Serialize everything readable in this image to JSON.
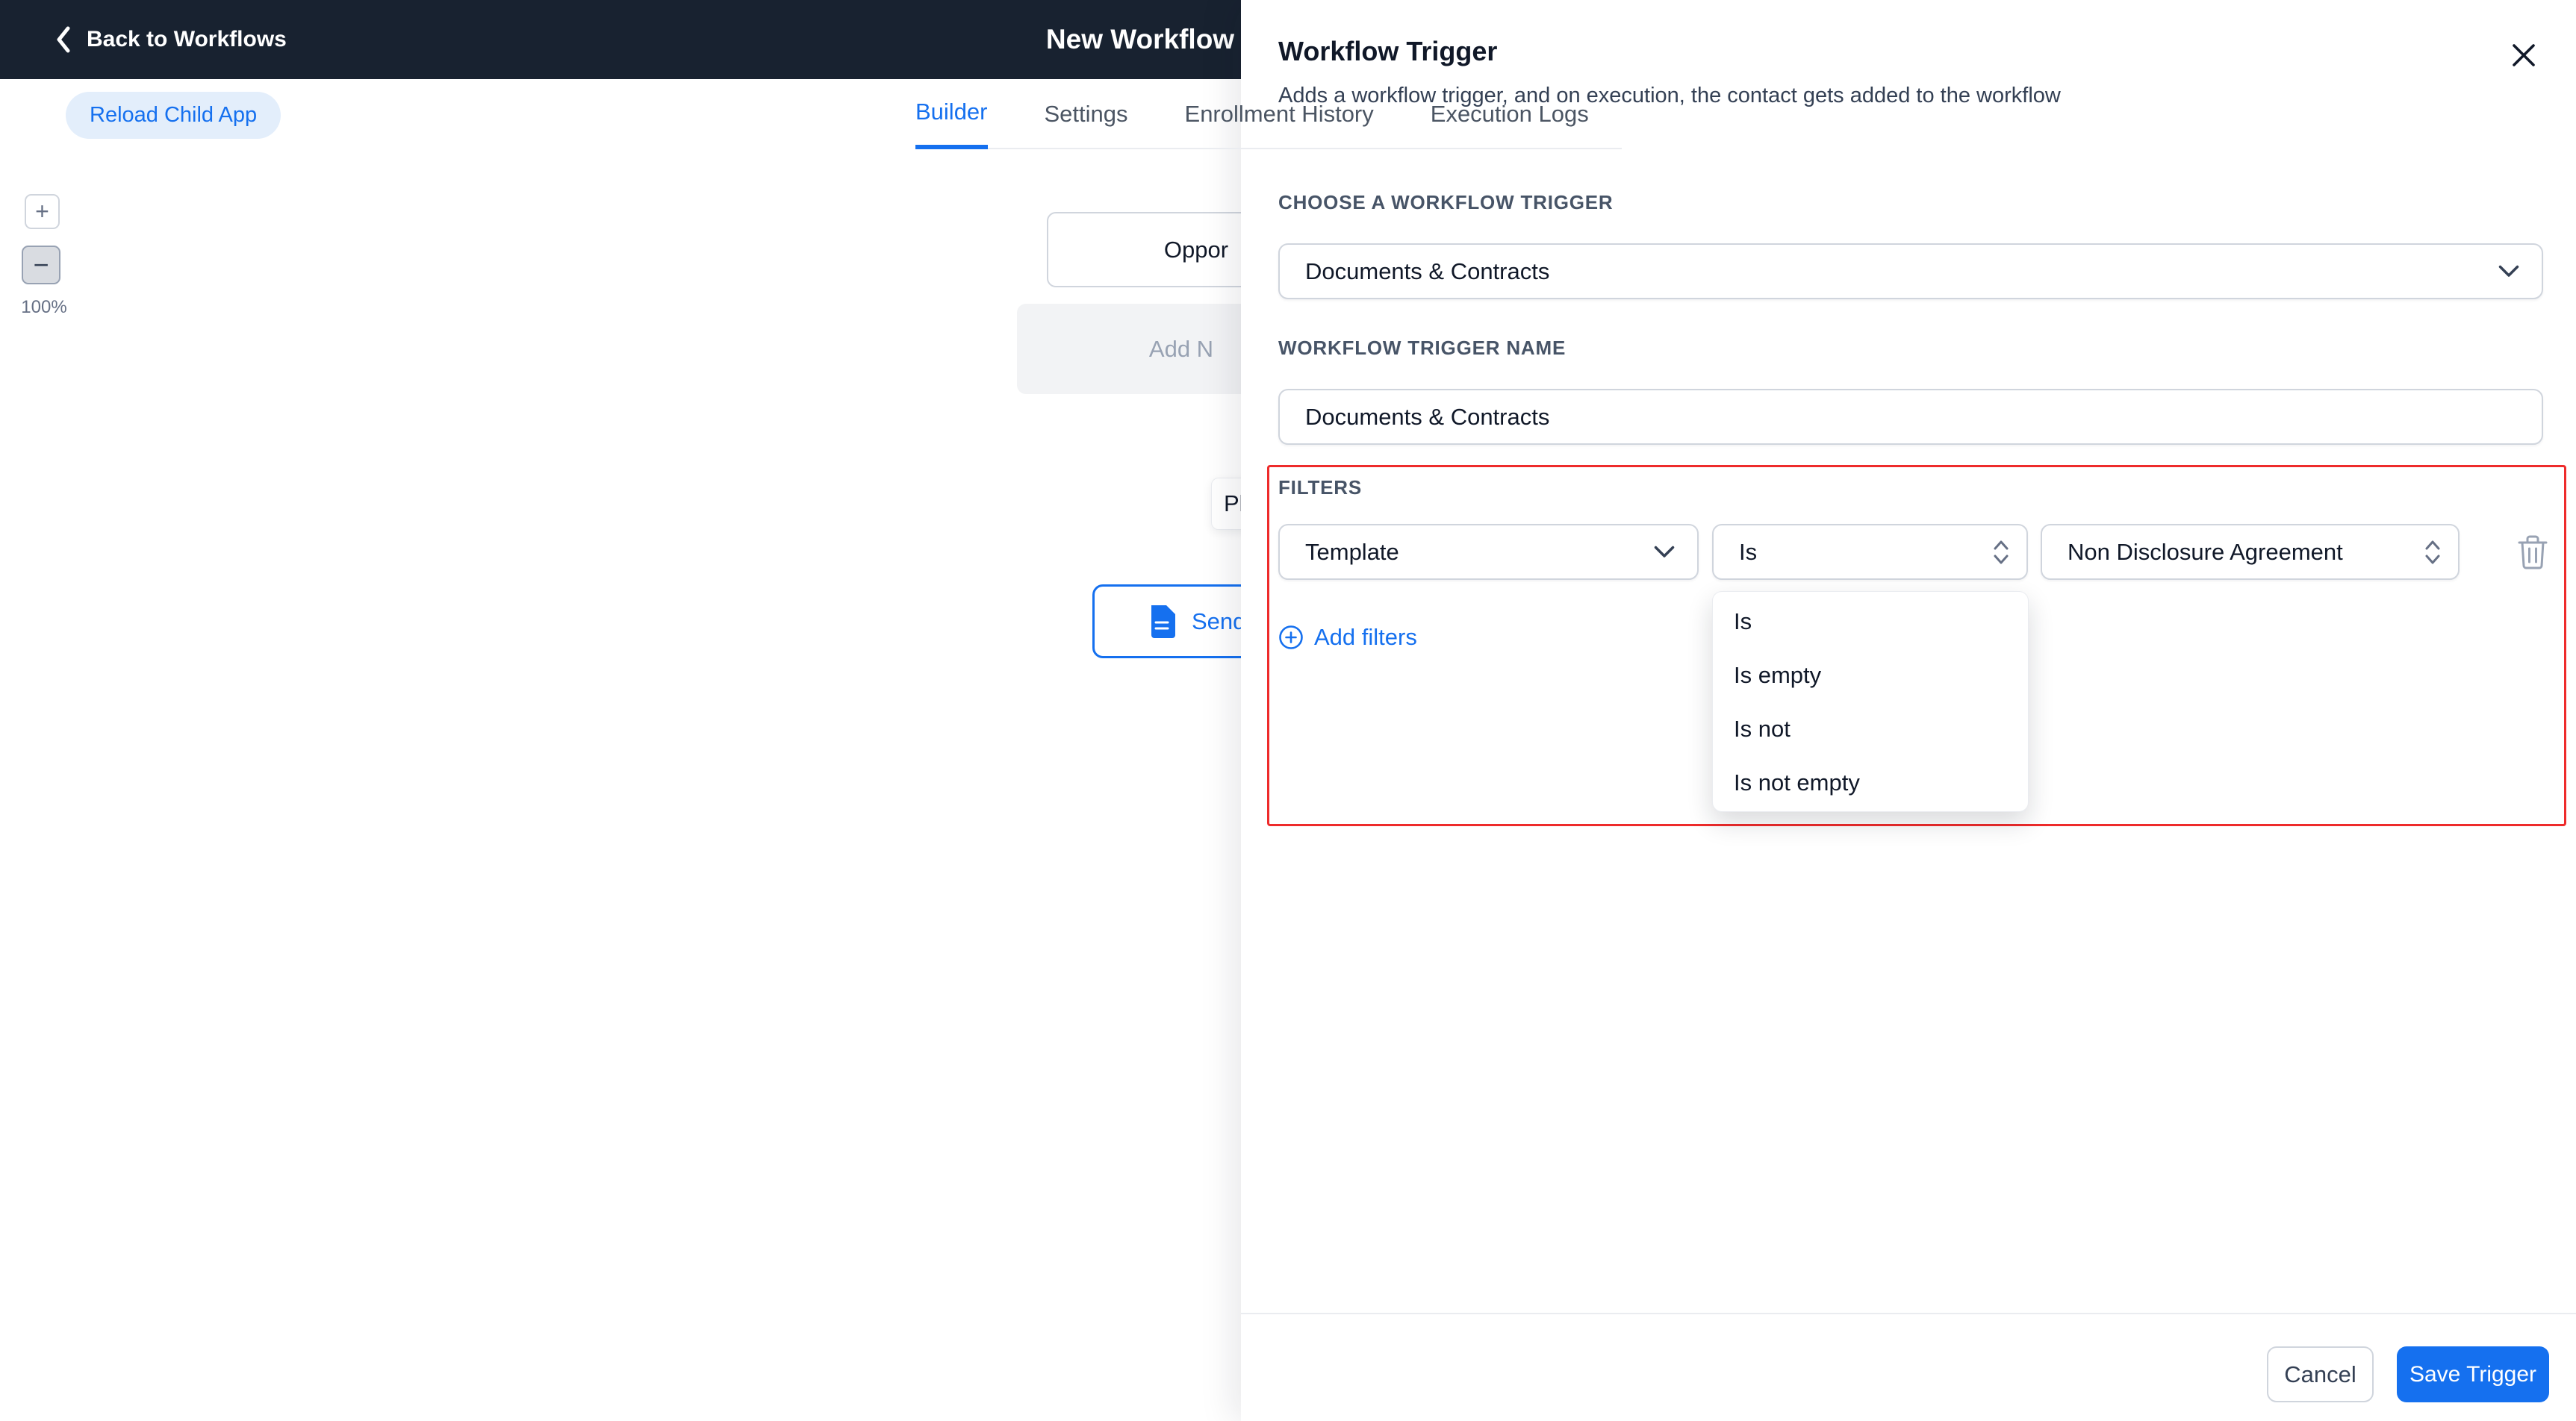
{
  "colors": {
    "accent_blue": "#1570EF",
    "topbar_bg": "#182230",
    "alert_red": "#EE2B2B"
  },
  "topbar": {
    "back_label": "Back to Workflows",
    "title": "New Workflow"
  },
  "main": {
    "reload_button_label": "Reload Child App",
    "tabs": [
      {
        "label": "Builder"
      },
      {
        "label": "Settings"
      },
      {
        "label": "Enrollment History"
      },
      {
        "label": "Execution Logs"
      }
    ],
    "zoom": {
      "plus": "+",
      "minus": "−",
      "level": "100%"
    },
    "canvas": {
      "node_title_partial": "Oppor",
      "node_add_partial": "Add N",
      "message_partial": "Pl",
      "send_label_partial": "Send"
    }
  },
  "panel": {
    "title": "Workflow Trigger",
    "subtitle": "Adds a workflow trigger, and on execution, the contact gets added to the workflow",
    "trigger_select_label": "CHOOSE A WORKFLOW TRIGGER",
    "trigger_select_value": "Documents & Contracts",
    "trigger_name_label": "WORKFLOW TRIGGER NAME",
    "trigger_name_value": "Documents & Contracts",
    "filters_label": "FILTERS",
    "filter_row": {
      "field_value": "Template",
      "operator_value": "Is",
      "value_value": "Non Disclosure Agreement"
    },
    "add_filters_label": "Add filters",
    "operator_options": [
      "Is",
      "Is empty",
      "Is not",
      "Is not empty"
    ],
    "footer": {
      "cancel_label": "Cancel",
      "save_label": "Save Trigger"
    }
  }
}
